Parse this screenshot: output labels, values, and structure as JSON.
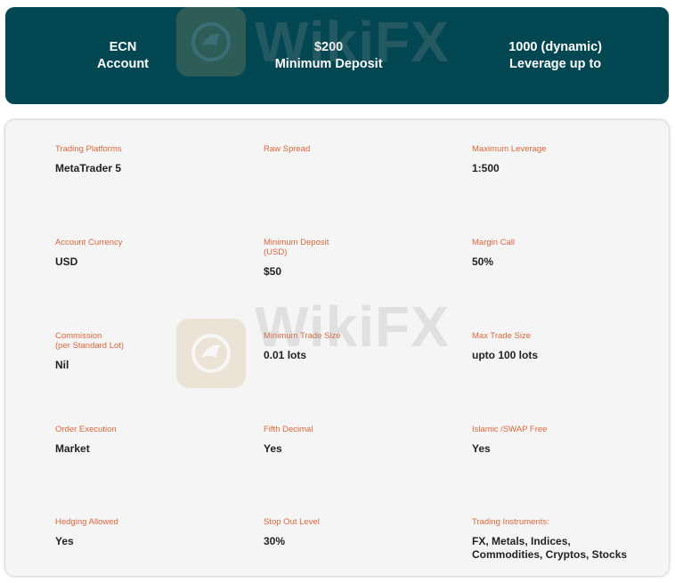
{
  "theme": {
    "banner_bg": "#034752",
    "label_color": "#d9663a",
    "value_color": "#222222"
  },
  "banner": {
    "account": [
      "ECN",
      "Account"
    ],
    "deposit": [
      "$200",
      "Minimum Deposit"
    ],
    "leverage": [
      "1000 (dynamic)",
      "Leverage up to"
    ]
  },
  "details": {
    "trading_platforms": {
      "label": "Trading Platforms",
      "value": "MetaTrader 5"
    },
    "raw_spread": {
      "label": "Raw Spread",
      "value": ""
    },
    "maximum_leverage": {
      "label": "Maximum Leverage",
      "value": "1:500"
    },
    "account_currency": {
      "label": "Account Currency",
      "value": "USD"
    },
    "minimum_deposit": {
      "label": [
        "Minimum Deposit",
        "(USD)"
      ],
      "value": "$50"
    },
    "margin_call": {
      "label": "Margin Call",
      "value": "50%"
    },
    "commission": {
      "label": [
        "Commission",
        "(per Standard Lot)"
      ],
      "value": "Nil"
    },
    "minimum_trade_size": {
      "label": "Minimum Trade Size",
      "value": "0.01 lots"
    },
    "max_trade_size": {
      "label": "Max Trade Size",
      "value": "upto 100 lots"
    },
    "order_execution": {
      "label": "Order Execution",
      "value": "Market"
    },
    "fifth_decimal": {
      "label": "Fifth Decimal",
      "value": "Yes"
    },
    "islamic_swap_free": {
      "label": "Islamic /SWAP Free",
      "value": "Yes"
    },
    "hedging_allowed": {
      "label": "Hedging Allowed",
      "value": "Yes"
    },
    "stop_out_level": {
      "label": "Stop Out Level",
      "value": "30%"
    },
    "trading_instruments": {
      "label": "Trading Instruments:",
      "value": [
        "FX, Metals, Indices,",
        "Commodities, Cryptos, Stocks"
      ]
    }
  },
  "watermark": {
    "text": "WikiFX",
    "icon": "eagle-icon"
  }
}
